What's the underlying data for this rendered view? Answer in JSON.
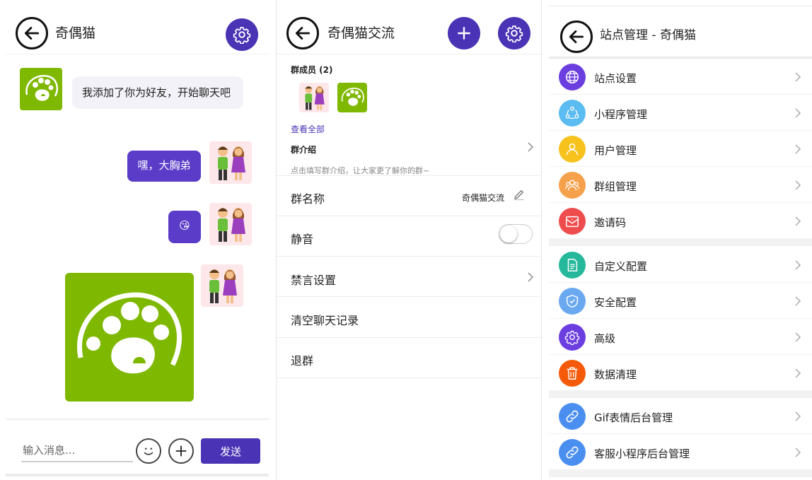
{
  "chat": {
    "title": "奇偶猫",
    "messages": [
      {
        "side": "left",
        "text": "我添加了你为好友，开始聊天吧"
      },
      {
        "side": "right",
        "text": "嘿，大胸弟"
      },
      {
        "side": "right",
        "text": "😘"
      }
    ],
    "input_placeholder": "输入消息...",
    "send_label": "发送"
  },
  "group": {
    "title": "奇偶猫交流",
    "members_label": "群成员 (2)",
    "view_all": "查看全部",
    "intro_label": "群介绍",
    "intro_hint": "点击填写群介绍，让大家更了解你的群~",
    "name_label": "群名称",
    "name_value": "奇偶猫交流",
    "mute_label": "静音",
    "mute_on": false,
    "ban_label": "禁言设置",
    "clear_label": "清空聊天记录",
    "quit_label": "退群"
  },
  "admin": {
    "title": "站点管理 - 奇偶猫",
    "items": [
      {
        "label": "站点设置",
        "icon": "globe-icon",
        "color": "#6b3ee0"
      },
      {
        "label": "小程序管理",
        "icon": "share-network-icon",
        "color": "#5bbcf2"
      },
      {
        "label": "用户管理",
        "icon": "user-icon",
        "color": "#f7c21c"
      },
      {
        "label": "群组管理",
        "icon": "group-icon",
        "color": "#f5a04a"
      },
      {
        "label": "邀请码",
        "icon": "mail-icon",
        "color": "#ef4d4d"
      },
      {
        "label": "自定义配置",
        "icon": "document-icon",
        "color": "#26b89a"
      },
      {
        "label": "安全配置",
        "icon": "shield-icon",
        "color": "#6aa8f0"
      },
      {
        "label": "高级",
        "icon": "gear-icon",
        "color": "#6b3ee0"
      },
      {
        "label": "数据清理",
        "icon": "trash-icon",
        "color": "#f45a0a"
      },
      {
        "label": "Gif表情后台管理",
        "icon": "link-icon",
        "color": "#4a8ff0"
      },
      {
        "label": "客服小程序后台管理",
        "icon": "link-icon",
        "color": "#4a8ff0"
      }
    ]
  },
  "colors": {
    "accent": "#4a33b5",
    "bubble_right": "#5a3cc8",
    "avatar_green": "#7fb800"
  }
}
